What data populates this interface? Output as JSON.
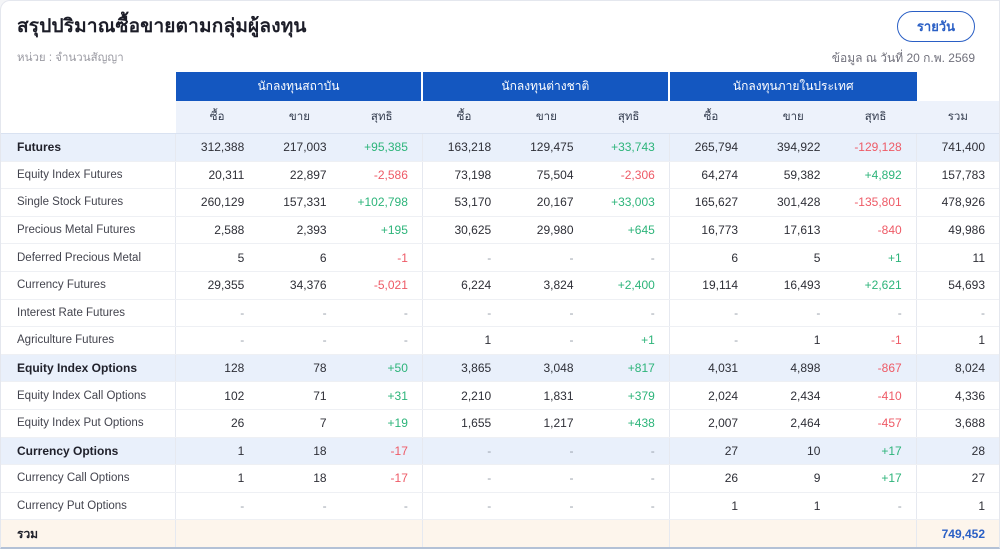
{
  "header": {
    "title": "สรุปปริมาณซื้อขายตามกลุ่มผู้ลงทุน",
    "unit_label": "หน่วย : จำนวนสัญญา",
    "as_of_label": "ข้อมูล ณ วันที่ 20 ก.พ. 2569",
    "period_button_label": "รายวัน"
  },
  "colors": {
    "header_blue": "#1457c0",
    "positive_green": "#2db47a",
    "negative_red": "#ee5a66",
    "total_blue": "#2a5fc5",
    "total_row_bg": "#fdf5ec",
    "section_row_bg": "#e9f0fb"
  },
  "table": {
    "groups": [
      {
        "label": "นักลงทุนสถาบัน"
      },
      {
        "label": "นักลงทุนต่างชาติ"
      },
      {
        "label": "นักลงทุนภายในประเทศ"
      }
    ],
    "subheaders": {
      "buy": "ซื้อ",
      "sell": "ขาย",
      "net": "สุทธิ",
      "total": "รวม"
    },
    "rows": [
      {
        "label": "Futures",
        "type": "section",
        "cells": [
          "312,388",
          "217,003",
          "+95,385",
          "163,218",
          "129,475",
          "+33,743",
          "265,794",
          "394,922",
          "-129,128",
          "741,400"
        ]
      },
      {
        "label": "Equity Index Futures",
        "type": "",
        "cells": [
          "20,311",
          "22,897",
          "-2,586",
          "73,198",
          "75,504",
          "-2,306",
          "64,274",
          "59,382",
          "+4,892",
          "157,783"
        ]
      },
      {
        "label": "Single Stock Futures",
        "type": "",
        "cells": [
          "260,129",
          "157,331",
          "+102,798",
          "53,170",
          "20,167",
          "+33,003",
          "165,627",
          "301,428",
          "-135,801",
          "478,926"
        ]
      },
      {
        "label": "Precious Metal Futures",
        "type": "",
        "cells": [
          "2,588",
          "2,393",
          "+195",
          "30,625",
          "29,980",
          "+645",
          "16,773",
          "17,613",
          "-840",
          "49,986"
        ]
      },
      {
        "label": "Deferred Precious Metal",
        "type": "",
        "cells": [
          "5",
          "6",
          "-1",
          "-",
          "-",
          "-",
          "6",
          "5",
          "+1",
          "11"
        ]
      },
      {
        "label": "Currency Futures",
        "type": "",
        "cells": [
          "29,355",
          "34,376",
          "-5,021",
          "6,224",
          "3,824",
          "+2,400",
          "19,114",
          "16,493",
          "+2,621",
          "54,693"
        ]
      },
      {
        "label": "Interest Rate Futures",
        "type": "",
        "cells": [
          "-",
          "-",
          "-",
          "-",
          "-",
          "-",
          "-",
          "-",
          "-",
          "-"
        ]
      },
      {
        "label": "Agriculture Futures",
        "type": "",
        "cells": [
          "-",
          "-",
          "-",
          "1",
          "-",
          "+1",
          "-",
          "1",
          "-1",
          "1"
        ]
      },
      {
        "label": "Equity Index Options",
        "type": "section",
        "cells": [
          "128",
          "78",
          "+50",
          "3,865",
          "3,048",
          "+817",
          "4,031",
          "4,898",
          "-867",
          "8,024"
        ]
      },
      {
        "label": "Equity Index Call Options",
        "type": "",
        "cells": [
          "102",
          "71",
          "+31",
          "2,210",
          "1,831",
          "+379",
          "2,024",
          "2,434",
          "-410",
          "4,336"
        ]
      },
      {
        "label": "Equity Index Put Options",
        "type": "",
        "cells": [
          "26",
          "7",
          "+19",
          "1,655",
          "1,217",
          "+438",
          "2,007",
          "2,464",
          "-457",
          "3,688"
        ]
      },
      {
        "label": "Currency Options",
        "type": "section",
        "cells": [
          "1",
          "18",
          "-17",
          "-",
          "-",
          "-",
          "27",
          "10",
          "+17",
          "28"
        ]
      },
      {
        "label": "Currency Call Options",
        "type": "",
        "cells": [
          "1",
          "18",
          "-17",
          "-",
          "-",
          "-",
          "26",
          "9",
          "+17",
          "27"
        ]
      },
      {
        "label": "Currency Put Options",
        "type": "",
        "cells": [
          "-",
          "-",
          "-",
          "-",
          "-",
          "-",
          "1",
          "1",
          "-",
          "1"
        ]
      },
      {
        "label": "รวม",
        "type": "total",
        "cells": [
          "",
          "",
          "",
          "",
          "",
          "",
          "",
          "",
          "",
          "749,452"
        ]
      }
    ]
  }
}
